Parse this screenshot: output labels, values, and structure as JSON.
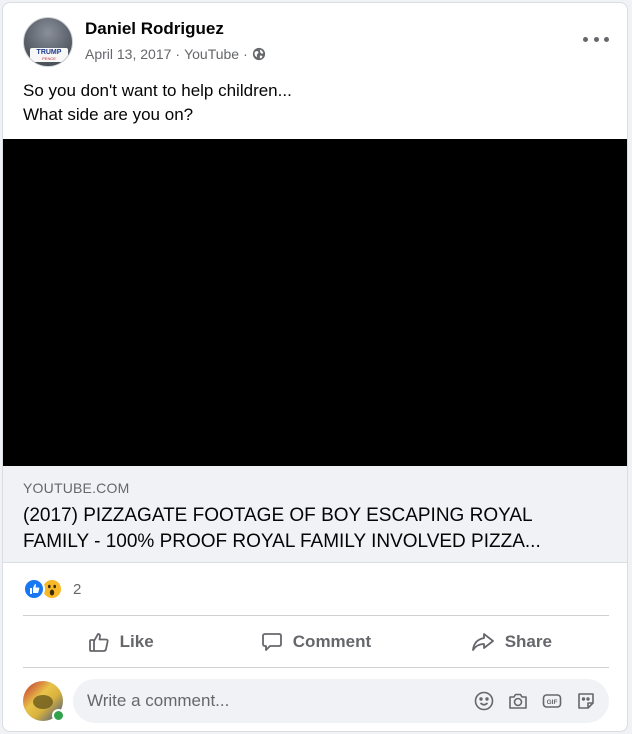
{
  "post": {
    "author": "Daniel Rodriguez",
    "date": "April 13, 2017",
    "source": "YouTube",
    "separator": "·",
    "privacy_icon": "globe-icon",
    "avatar_sign_top": "TRUMP",
    "avatar_sign_bottom": "PENCE",
    "message_lines": [
      "So you don't want to help children...",
      "What side are you on?"
    ]
  },
  "link_preview": {
    "domain": "YOUTUBE.COM",
    "title_lines": [
      "(2017) PIZZAGATE FOOTAGE OF BOY ESCAPING ROYAL",
      "FAMILY - 100% PROOF ROYAL FAMILY INVOLVED PIZZA..."
    ]
  },
  "reactions": {
    "icons": [
      "like-reaction-icon",
      "wow-reaction-icon"
    ],
    "count": "2"
  },
  "actions": {
    "like_label": "Like",
    "comment_label": "Comment",
    "share_label": "Share"
  },
  "comment_input": {
    "placeholder": "Write a comment...",
    "tools": [
      "emoji-icon",
      "camera-icon",
      "gif-icon",
      "sticker-icon"
    ]
  },
  "colors": {
    "accent_blue": "#1877f2",
    "wow_yellow": "#f7b928",
    "secondary_text": "#65676b",
    "online_green": "#31a24c"
  }
}
